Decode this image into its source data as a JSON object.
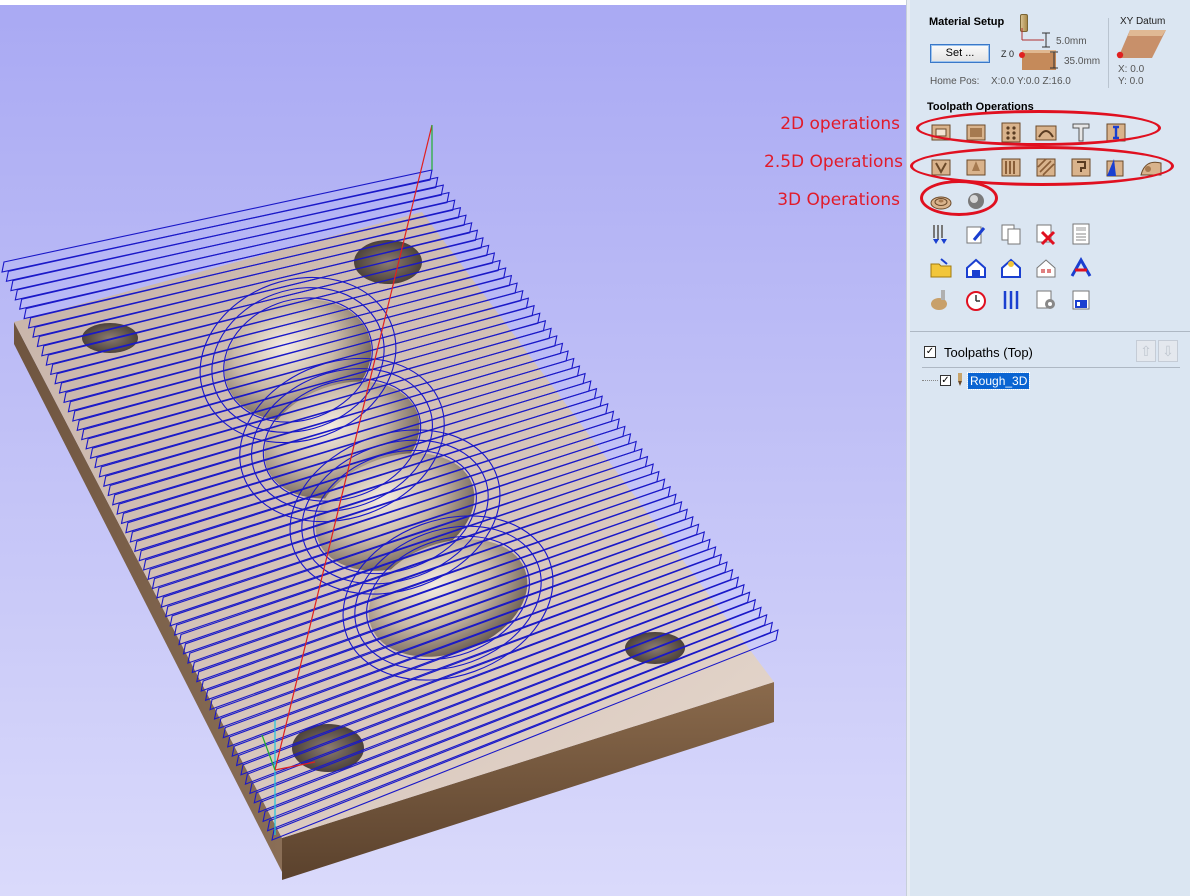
{
  "material_setup": {
    "title": "Material Setup",
    "set_button": "Set ...",
    "z_zero_label": "Z 0",
    "top_offset": "5.0mm",
    "thickness": "35.0mm",
    "home_pos_label": "Home Pos:",
    "home_pos_value": "X:0.0 Y:0.0 Z:16.0"
  },
  "xy_datum": {
    "title": "XY Datum",
    "x": "X: 0.0",
    "y": "Y: 0.0"
  },
  "toolpath_operations": {
    "title": "Toolpath Operations",
    "annotations": {
      "op2d": "2D operations",
      "op25d": "2.5D Operations",
      "op3d": "3D Operations"
    },
    "icons_2d": [
      "profile-toolpath-icon",
      "pocket-toolpath-icon",
      "drilling-toolpath-icon",
      "quick-engrave-icon",
      "texture-t-icon",
      "inlay-icon"
    ],
    "icons_25d": [
      "v-carve-icon",
      "prism-carve-icon",
      "fluting-toolpath-icon",
      "texture-toolpath-icon",
      "moulding-toolpath-icon",
      "chamfer-toolpath-icon",
      "3d-relief-icon"
    ],
    "icons_3d": [
      "3d-roughing-icon",
      "3d-finishing-icon"
    ]
  },
  "toolpaths_list": {
    "title": "Toolpaths (Top)",
    "items": [
      {
        "name": "Rough_3D",
        "checked": true
      }
    ]
  },
  "colors": {
    "annotation_red": "#e01020",
    "toolpath_blue": "#1a18c8",
    "panel_bg": "#dbe6f2",
    "selection_blue": "#0a64d2"
  }
}
